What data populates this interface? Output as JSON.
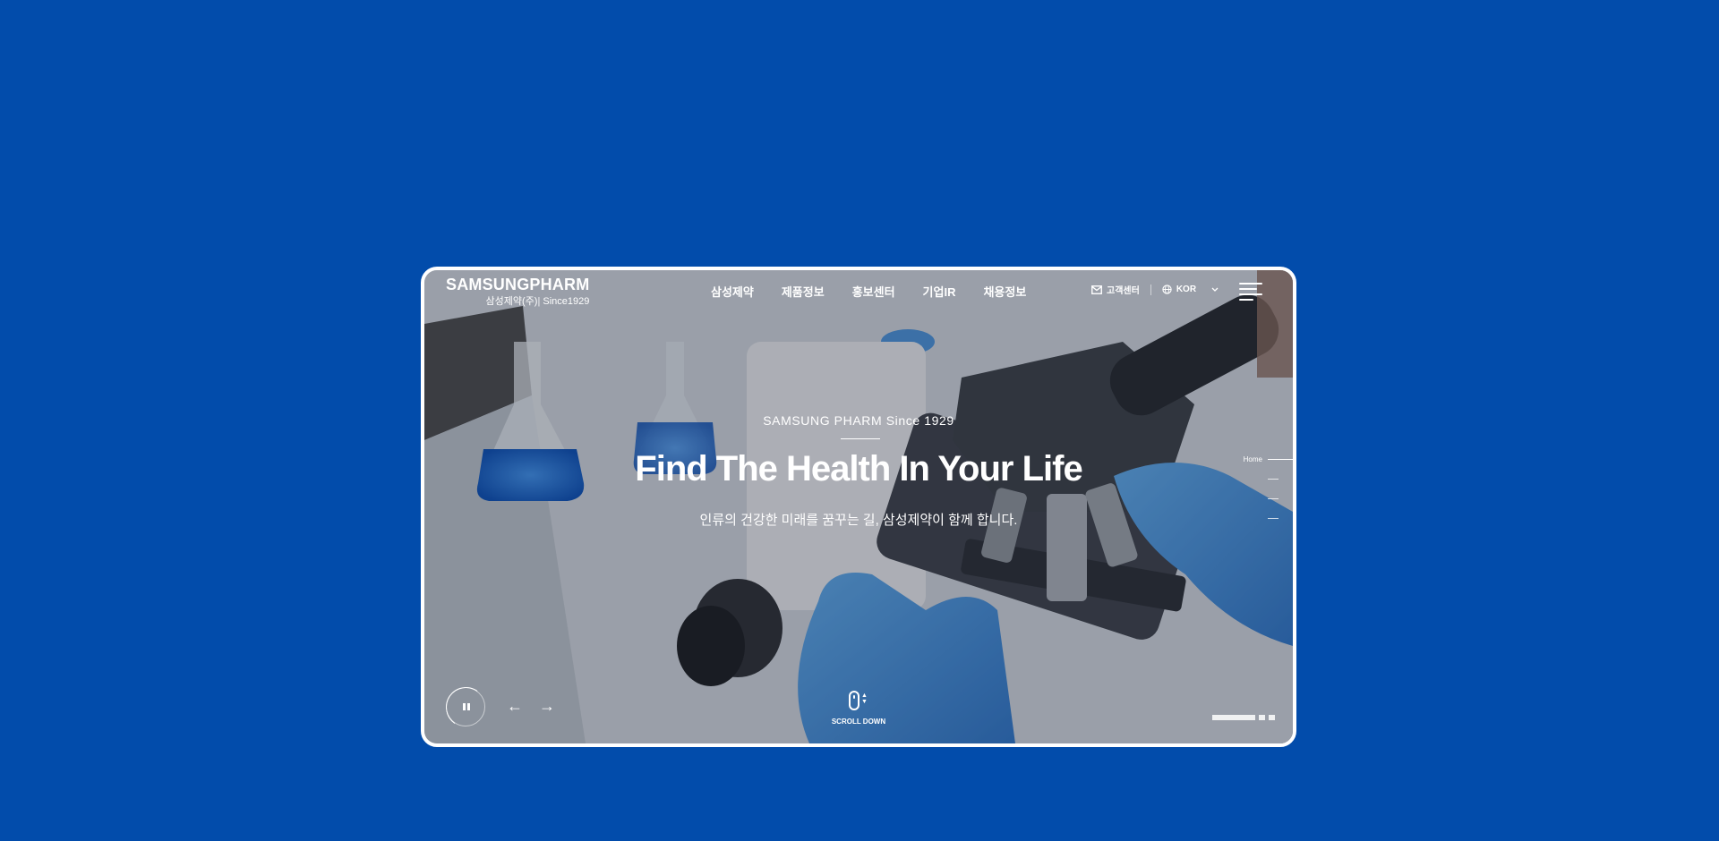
{
  "header": {
    "logo_main": "SAMSUNGPHARM",
    "logo_sub_kr": "삼성제약(주)",
    "logo_sub_sep": "|",
    "logo_sub_since": "Since1929",
    "nav": [
      "삼성제약",
      "제품정보",
      "홍보센터",
      "기업IR",
      "채용정보"
    ],
    "customer_center": "고객센터",
    "language": "KOR",
    "icons": {
      "customer_center": "mail-icon",
      "language": "globe-icon",
      "dropdown": "chevron-down-icon",
      "menu": "hamburger-menu-icon"
    }
  },
  "hero": {
    "eyebrow": "SAMSUNG PHARM Since 1929",
    "title": "Find The Health In Your Life",
    "description": "인류의 건강한 미래를 꿈꾸는 길, 삼성제약이 함께 합니다."
  },
  "side_nav": {
    "items": [
      "Home",
      "",
      "",
      ""
    ],
    "active_index": 0
  },
  "controls": {
    "pause_icon": "pause-icon",
    "prev_arrow": "←",
    "next_arrow": "→",
    "scroll_label": "SCROLL DOWN",
    "scroll_icon": "mouse-scroll-icon",
    "slides_total": 3,
    "slide_active": 1
  },
  "theme": {
    "background": "#024cab",
    "frame_border": "#ffffff",
    "text": "#ffffff"
  }
}
